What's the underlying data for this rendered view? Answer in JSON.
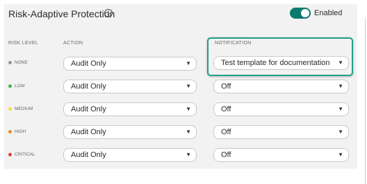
{
  "header": {
    "title": "Risk-Adaptive Protection",
    "toggle_label": "Enabled",
    "toggle_on": true,
    "accent_color": "#0a7a6e"
  },
  "columns": {
    "risk_level": "RISK LEVEL",
    "action": "ACTION",
    "notification": "NOTIFICATION"
  },
  "rows": [
    {
      "level": "NONE",
      "dot_color": "#8a9aa0",
      "action": "Audit Only",
      "notification": "Test template for documentation"
    },
    {
      "level": "LOW",
      "dot_color": "#4caf50",
      "action": "Audit Only",
      "notification": "Off"
    },
    {
      "level": "MEDIUM",
      "dot_color": "#f2dc3a",
      "action": "Audit Only",
      "notification": "Off"
    },
    {
      "level": "HIGH",
      "dot_color": "#f08a24",
      "action": "Audit Only",
      "notification": "Off"
    },
    {
      "level": "CRITICAL",
      "dot_color": "#e53935",
      "action": "Audit Only",
      "notification": "Off"
    }
  ]
}
